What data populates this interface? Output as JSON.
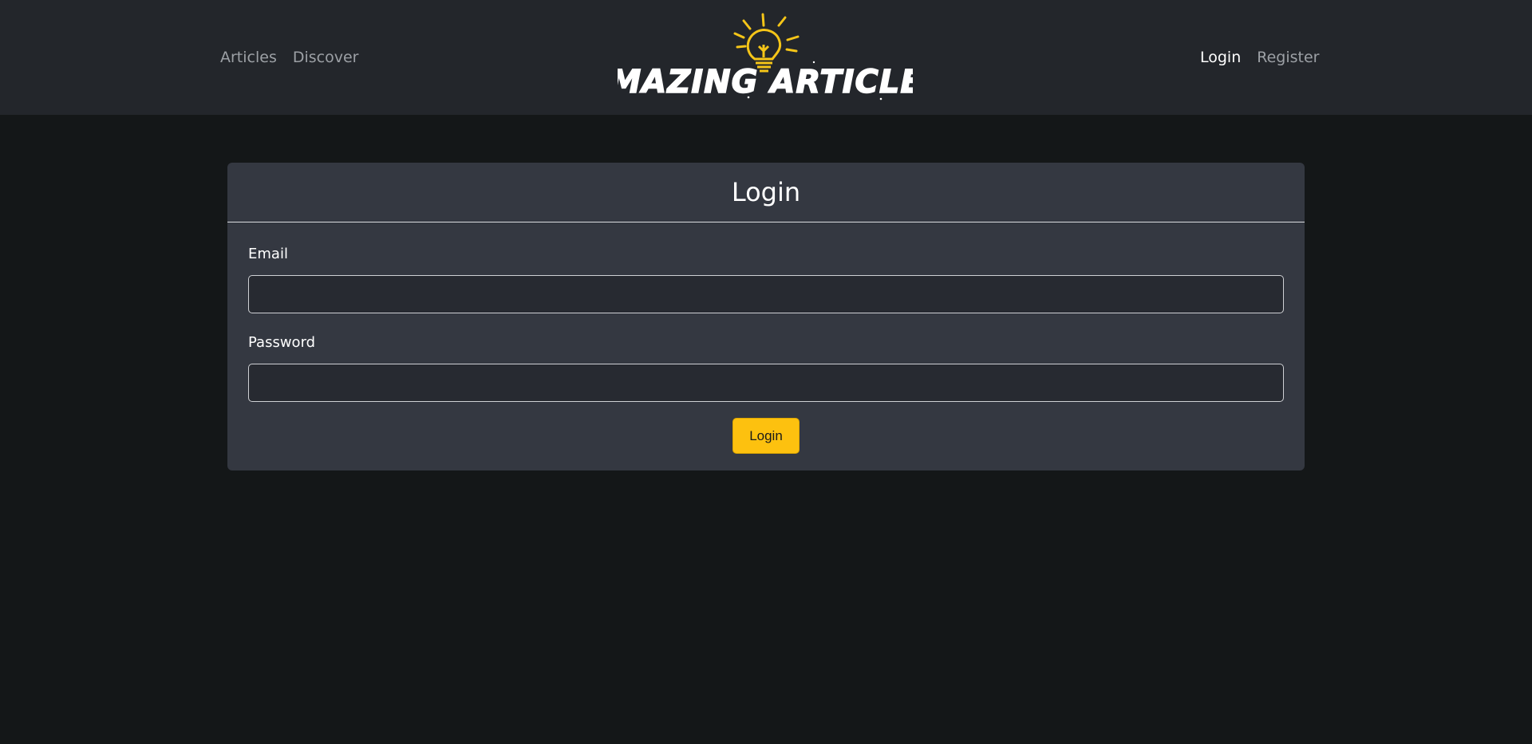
{
  "nav": {
    "left_links": [
      "Articles",
      "Discover"
    ],
    "right_links": [
      "Login",
      "Register"
    ],
    "active": "Login"
  },
  "logo": {
    "text": "AMAZING ARTICLES",
    "icon": "lightbulb-icon",
    "accent_color": "#f5c518"
  },
  "login_form": {
    "title": "Login",
    "email_label": "Email",
    "email_value": "",
    "password_label": "Password",
    "password_value": "",
    "submit_label": "Login"
  },
  "colors": {
    "page_bg": "#141718",
    "navbar_bg": "#23262b",
    "card_bg": "#343841",
    "button_bg": "#fdc10f"
  }
}
